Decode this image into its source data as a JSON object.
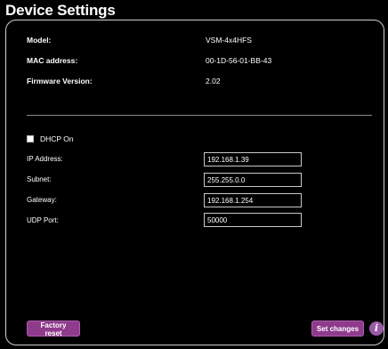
{
  "title": "Device Settings",
  "device_info": {
    "model_label": "Model:",
    "model_value": "VSM-4x4HFS",
    "mac_label": "MAC address:",
    "mac_value": "00-1D-56-01-BB-43",
    "firmware_label": "Firmware Version:",
    "firmware_value": "2.02"
  },
  "network": {
    "dhcp_label": "DHCP On",
    "dhcp_checked": false,
    "ip_label": "IP Address:",
    "ip_value": "192.168.1.39",
    "subnet_label": "Subnet:",
    "subnet_value": "255.255.0.0",
    "gateway_label": "Gateway:",
    "gateway_value": "192.168.1.254",
    "udp_label": "UDP Port:",
    "udp_value": "50000"
  },
  "actions": {
    "factory_reset_label": "Factory reset",
    "set_changes_label": "Set changes",
    "info_icon_glyph": "i"
  },
  "colors": {
    "background": "#000000",
    "accent_purple": "#8e3b8c",
    "info_icon": "#9a5aa6"
  }
}
